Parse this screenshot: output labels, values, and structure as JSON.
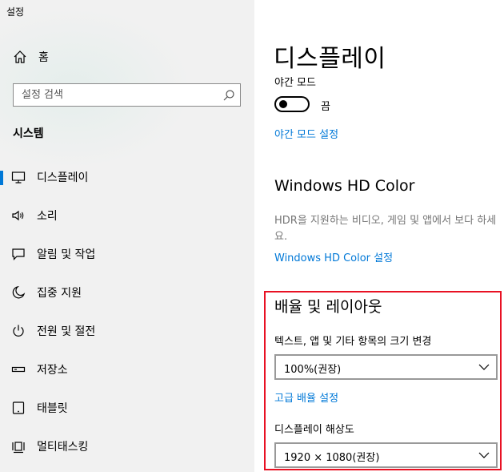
{
  "window": {
    "title": "설정"
  },
  "sidebar": {
    "home_label": "홈",
    "search_placeholder": "설정 검색",
    "section_label": "시스템",
    "items": [
      {
        "label": "디스플레이",
        "icon": "monitor-icon",
        "active": true
      },
      {
        "label": "소리",
        "icon": "speaker-icon"
      },
      {
        "label": "알림 및 작업",
        "icon": "notification-icon"
      },
      {
        "label": "집중 지원",
        "icon": "moon-icon"
      },
      {
        "label": "전원 및 절전",
        "icon": "power-icon"
      },
      {
        "label": "저장소",
        "icon": "storage-icon"
      },
      {
        "label": "태블릿",
        "icon": "tablet-icon"
      },
      {
        "label": "멀티태스킹",
        "icon": "multitasking-icon"
      }
    ]
  },
  "main": {
    "page_title": "디스플레이",
    "night_light": {
      "label": "야간 모드",
      "state": "끔",
      "enabled": false,
      "settings_link": "야간 모드 설정"
    },
    "hdr": {
      "title": "Windows HD Color",
      "description": "HDR을 지원하는 비디오, 게임 및 앱에서 보다 하세요.",
      "settings_link": "Windows HD Color 설정"
    },
    "scale_layout": {
      "title": "배율 및 레이아웃",
      "text_size_label": "텍스트, 앱 및 기타 항목의 크기 변경",
      "text_size_value": "100%(권장)",
      "advanced_link": "고급 배율 설정",
      "resolution_label": "디스플레이 해상도",
      "resolution_value": "1920 × 1080(권장)"
    }
  },
  "colors": {
    "accent": "#0078d7",
    "highlight_border": "#e81123",
    "sidebar_bg": "#f1f1f1"
  }
}
